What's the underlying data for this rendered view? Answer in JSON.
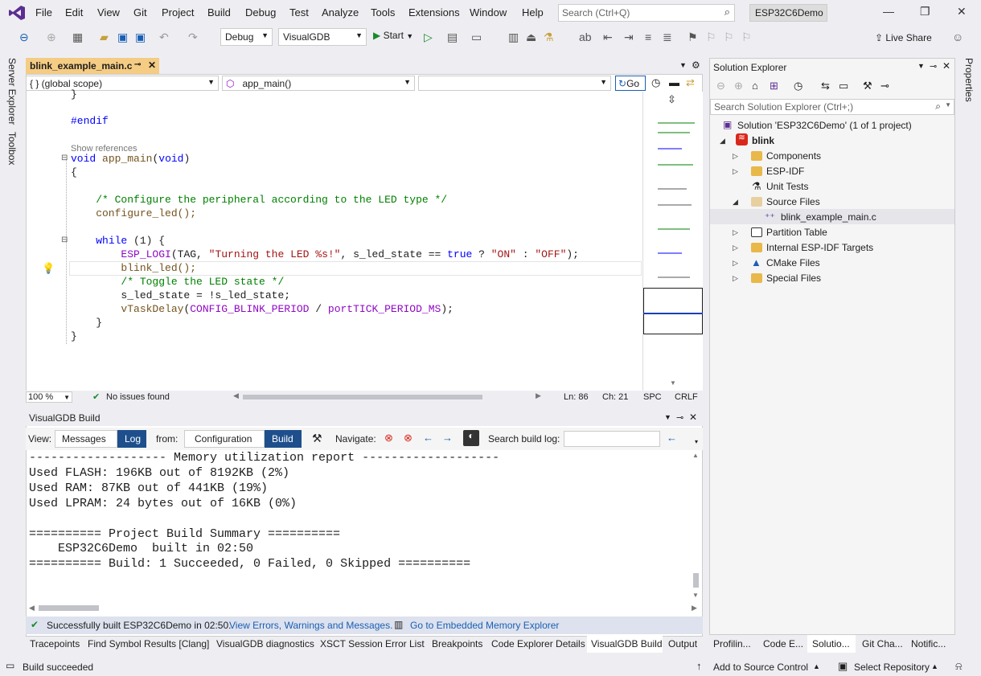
{
  "menu": [
    "File",
    "Edit",
    "View",
    "Git",
    "Project",
    "Build",
    "Debug",
    "Test",
    "Analyze",
    "Tools",
    "Extensions",
    "Window",
    "Help"
  ],
  "search": {
    "placeholder": "Search (Ctrl+Q)"
  },
  "solution_name": "ESP32C6Demo",
  "toolbar": {
    "config": "Debug",
    "platform": "VisualGDB",
    "start": "Start",
    "live_share": "Live Share"
  },
  "left_rail": [
    "Server Explorer",
    "Toolbox"
  ],
  "right_rail": [
    "Properties"
  ],
  "editor": {
    "tab": "blink_example_main.c",
    "scope": "{ }  (global scope)",
    "function": "app_main()",
    "go": "Go",
    "show_refs": "Show references",
    "zoom": "100 %",
    "issues": "No issues found",
    "ln": "Ln: 86",
    "ch": "Ch: 21",
    "spc": "SPC",
    "crlf": "CRLF"
  },
  "code_lines": [
    {
      "t": "}",
      "c": ""
    },
    {
      "t": "#endif",
      "c": "kw"
    },
    {
      "t": "void app_main(void)",
      "c": ""
    },
    {
      "t": "{",
      "c": ""
    },
    {
      "t": "    /* Configure the peripheral according to the LED type */",
      "c": "cmt"
    },
    {
      "t": "    configure_led();",
      "c": "fn"
    },
    {
      "t": "    while (1) {",
      "c": ""
    },
    {
      "t": "        ESP_LOGI(TAG, \"Turning the LED %s!\", s_led_state == true ? \"ON\" : \"OFF\");",
      "c": ""
    },
    {
      "t": "        blink_led();",
      "c": "fn"
    },
    {
      "t": "        /* Toggle the LED state */",
      "c": "cmt"
    },
    {
      "t": "        s_led_state = !s_led_state;",
      "c": ""
    },
    {
      "t": "        vTaskDelay(CONFIG_BLINK_PERIOD / portTICK_PERIOD_MS);",
      "c": ""
    },
    {
      "t": "    }",
      "c": ""
    },
    {
      "t": "}",
      "c": ""
    }
  ],
  "solution_explorer": {
    "title": "Solution Explorer",
    "search_placeholder": "Search Solution Explorer (Ctrl+;)",
    "root": "Solution 'ESP32C6Demo' (1 of 1 project)",
    "project": "blink",
    "items": [
      "Components",
      "ESP-IDF",
      "Unit Tests",
      "Source Files",
      "blink_example_main.c",
      "Partition Table",
      "Internal ESP-IDF Targets",
      "CMake Files",
      "Special Files"
    ],
    "tabs": [
      "Profilin...",
      "Code E...",
      "Solutio...",
      "Git Cha...",
      "Notific..."
    ]
  },
  "build": {
    "title": "VisualGDB Build",
    "view_label": "View:",
    "messages": "Messages",
    "log": "Log",
    "from_label": "from:",
    "configuration": "Configuration",
    "build": "Build",
    "navigate": "Navigate:",
    "search_label": "Search build log:",
    "log_text": "------------------- Memory utilization report -------------------\nUsed FLASH: 196KB out of 8192KB (2%)\nUsed RAM: 87KB out of 441KB (19%)\nUsed LPRAM: 24 bytes out of 16KB (0%)\n\n========== Project Build Summary ==========\n    ESP32C6Demo  built in 02:50\n========== Build: 1 Succeeded, 0 Failed, 0 Skipped ==========",
    "status": "Successfully built ESP32C6Demo in 02:50.",
    "link1": "View Errors, Warnings and Messages.",
    "link2": "Go to Embedded Memory Explorer"
  },
  "bottom_tabs": [
    "Tracepoints",
    "Find Symbol Results [Clang]",
    "VisualGDB diagnostics",
    "XSCT Session",
    "Error List",
    "Breakpoints",
    "Code Explorer Details",
    "VisualGDB Build",
    "Output"
  ],
  "statusbar": {
    "left": "Build succeeded",
    "source_control": "Add to Source Control",
    "repo": "Select Repository"
  },
  "colors": {
    "accent": "#5c2d91",
    "tab_active": "#f5cc84",
    "build_status": "#dde2ee",
    "link": "#1a5fb4"
  }
}
